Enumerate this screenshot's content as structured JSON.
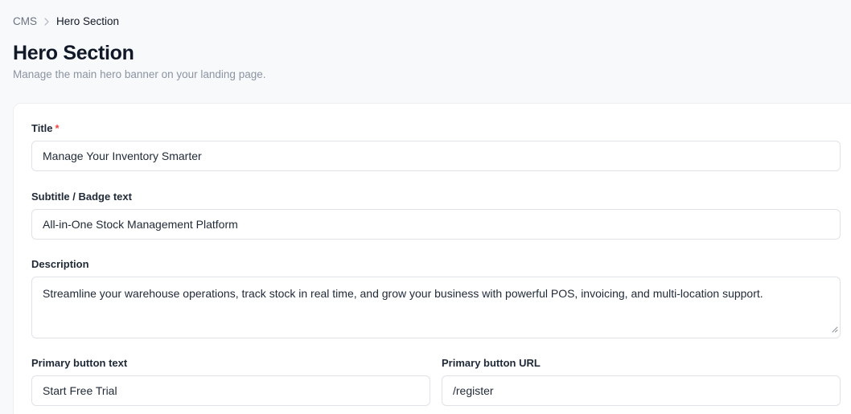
{
  "breadcrumb": {
    "root": "CMS",
    "current": "Hero Section"
  },
  "header": {
    "title": "Hero Section",
    "subtitle": "Manage the main hero banner on your landing page."
  },
  "form": {
    "title": {
      "label": "Title",
      "required_mark": "*",
      "value": "Manage Your Inventory Smarter"
    },
    "subtitle": {
      "label": "Subtitle / Badge text",
      "value": "All-in-One Stock Management Platform"
    },
    "description": {
      "label": "Description",
      "value": "Streamline your warehouse operations, track stock in real time, and grow your business with powerful POS, invoicing, and multi-location support."
    },
    "primary_button_text": {
      "label": "Primary button text",
      "value": "Start Free Trial"
    },
    "primary_button_url": {
      "label": "Primary button URL",
      "value": "/register"
    }
  },
  "icons": {
    "breadcrumb_separator": "chevron-right-icon",
    "textarea_resize": "resize-handle-icon"
  }
}
